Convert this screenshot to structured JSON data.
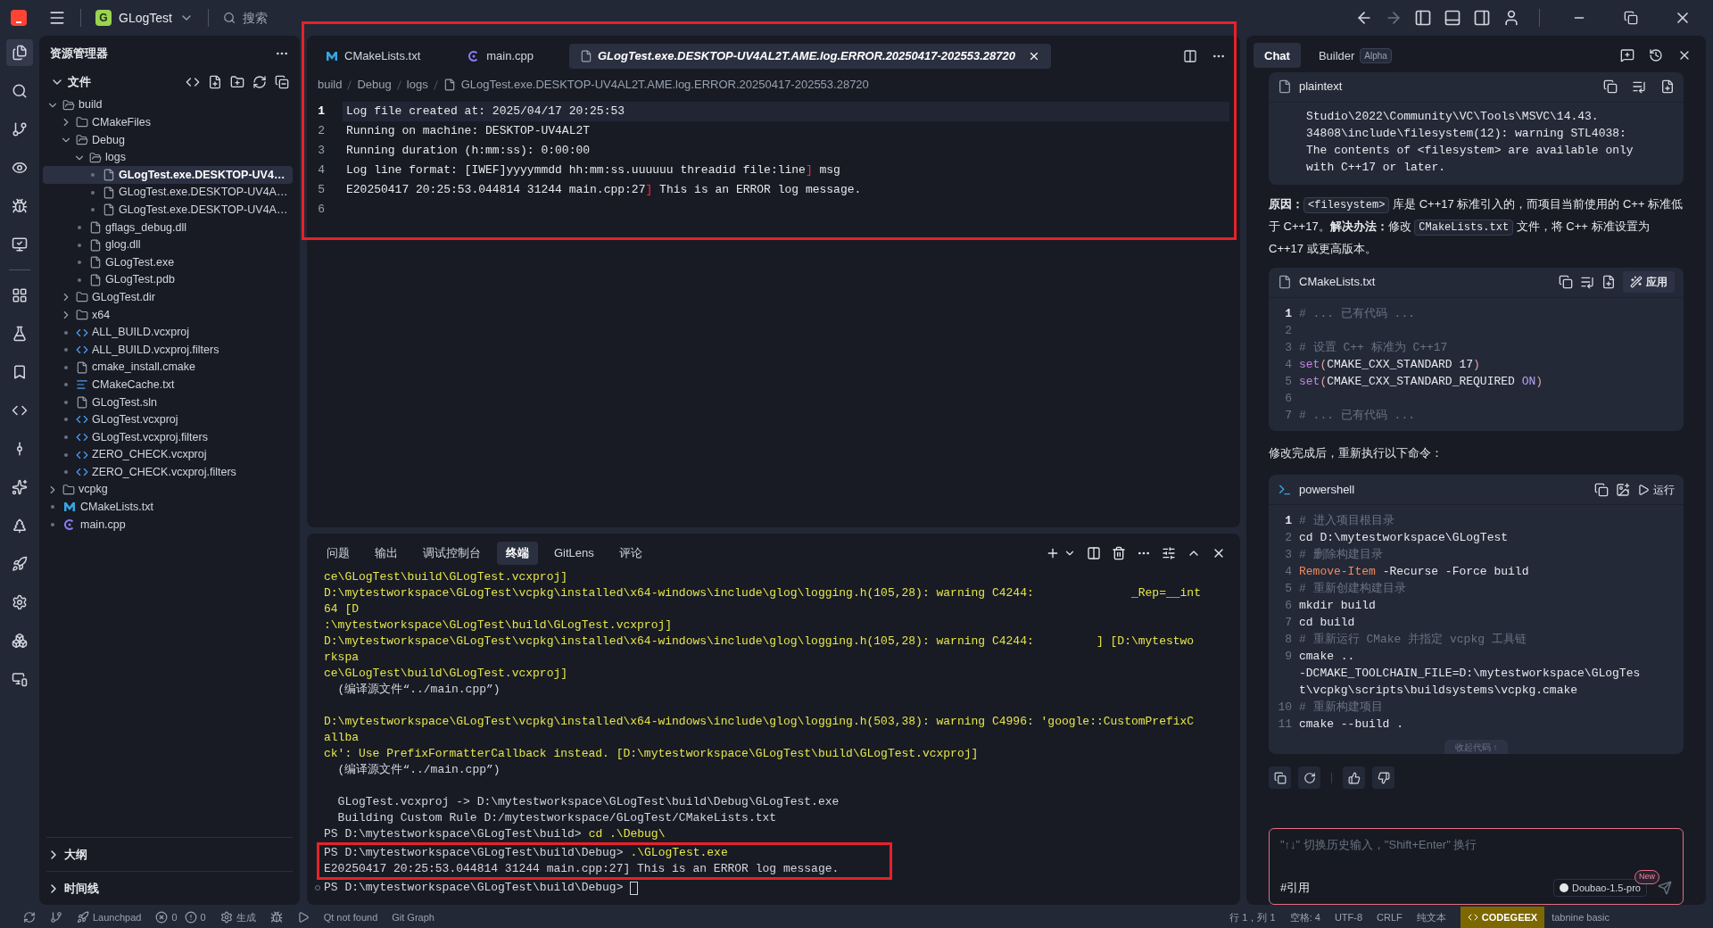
{
  "title_bar": {
    "project_badge": "G",
    "project": "GLogTest",
    "search": {
      "placeholder": "搜索"
    }
  },
  "explorer": {
    "title": "资源管理器",
    "section": "文件",
    "tree": [
      {
        "name": "build",
        "kind": "folder",
        "expanded": true,
        "selected": false,
        "children": [
          {
            "name": "CMakeFiles",
            "kind": "folder",
            "expanded": false,
            "selected": false
          },
          {
            "name": "Debug",
            "kind": "folder",
            "expanded": true,
            "selected": false,
            "children": [
              {
                "name": "logs",
                "kind": "folder",
                "expanded": true,
                "selected": false,
                "children": [
                  {
                    "name": "GLogTest.exe.DESKTOP-UV4…",
                    "kind": "file",
                    "selected": true
                  },
                  {
                    "name": "GLogTest.exe.DESKTOP-UV4A…",
                    "kind": "file",
                    "selected": false
                  },
                  {
                    "name": "GLogTest.exe.DESKTOP-UV4A…",
                    "kind": "file",
                    "selected": false
                  }
                ]
              },
              {
                "name": "gflags_debug.dll",
                "kind": "file",
                "selected": false
              },
              {
                "name": "glog.dll",
                "kind": "file",
                "selected": false
              },
              {
                "name": "GLogTest.exe",
                "kind": "file",
                "selected": false
              },
              {
                "name": "GLogTest.pdb",
                "kind": "file",
                "selected": false
              }
            ]
          },
          {
            "name": "GLogTest.dir",
            "kind": "folder",
            "expanded": false,
            "selected": false
          },
          {
            "name": "x64",
            "kind": "folder",
            "expanded": false,
            "selected": false
          },
          {
            "name": "ALL_BUILD.vcxproj",
            "kind": "code",
            "selected": false
          },
          {
            "name": "ALL_BUILD.vcxproj.filters",
            "kind": "code",
            "selected": false
          },
          {
            "name": "cmake_install.cmake",
            "kind": "file",
            "selected": false
          },
          {
            "name": "CMakeCache.txt",
            "kind": "list",
            "selected": false
          },
          {
            "name": "GLogTest.sln",
            "kind": "file",
            "selected": false
          },
          {
            "name": "GLogTest.vcxproj",
            "kind": "code",
            "selected": false
          },
          {
            "name": "GLogTest.vcxproj.filters",
            "kind": "code",
            "selected": false
          },
          {
            "name": "ZERO_CHECK.vcxproj",
            "kind": "code",
            "selected": false
          },
          {
            "name": "ZERO_CHECK.vcxproj.filters",
            "kind": "code",
            "selected": false
          }
        ]
      },
      {
        "name": "vcpkg",
        "kind": "folder",
        "expanded": false,
        "selected": false
      },
      {
        "name": "CMakeLists.txt",
        "kind": "cmake",
        "selected": false
      },
      {
        "name": "main.cpp",
        "kind": "cpp",
        "selected": false
      }
    ],
    "bottom_sections": [
      {
        "label": "大纲",
        "expanded": false
      },
      {
        "label": "时间线",
        "expanded": false
      }
    ]
  },
  "editor": {
    "tabs": [
      {
        "label": "CMakeLists.txt",
        "kind": "cmake",
        "selected": false
      },
      {
        "label": "main.cpp",
        "kind": "cpp",
        "selected": false
      },
      {
        "label": "GLogTest.exe.DESKTOP-UV4AL2T.AME.log.ERROR.20250417-202553.28720",
        "kind": "file",
        "selected": true
      }
    ],
    "breadcrumb": [
      "build",
      "Debug",
      "logs",
      "GLogTest.exe.DESKTOP-UV4AL2T.AME.log.ERROR.20250417-202553.28720"
    ],
    "lines": [
      {
        "number": "1",
        "selected": true,
        "segments": [
          {
            "kind": "text",
            "text": "Log file created at: 2025/04/17 20:25:53"
          }
        ]
      },
      {
        "number": "2",
        "selected": false,
        "segments": [
          {
            "kind": "text",
            "text": "Running on machine: DESKTOP-UV4AL2T"
          }
        ]
      },
      {
        "number": "3",
        "selected": false,
        "segments": [
          {
            "kind": "text",
            "text": "Running duration (h:mm:ss): 0:00:00"
          }
        ]
      },
      {
        "number": "4",
        "selected": false,
        "segments": [
          {
            "kind": "text",
            "text": "Log line format: [IWEF]yyyymmdd hh:mm:ss.uuuuuu threadid file:line"
          },
          {
            "kind": "bracket",
            "text": "]"
          },
          {
            "kind": "text",
            "text": " msg"
          }
        ]
      },
      {
        "number": "5",
        "selected": false,
        "segments": [
          {
            "kind": "text",
            "text": "E20250417 20:25:53.044814 31244 main.cpp:27"
          },
          {
            "kind": "bracket",
            "text": "]"
          },
          {
            "kind": "text",
            "text": " This is an ERROR log message."
          }
        ]
      },
      {
        "number": "6",
        "selected": false
      }
    ]
  },
  "panel": {
    "tabs": [
      {
        "label": "问题",
        "selected": false
      },
      {
        "label": "输出",
        "selected": false
      },
      {
        "label": "调试控制台",
        "selected": false
      },
      {
        "label": "终端",
        "selected": true
      },
      {
        "label": "GitLens",
        "selected": false
      },
      {
        "label": "评论",
        "selected": false
      }
    ],
    "terminal_lines": [
      {
        "kind": "warning",
        "text": "ce\\GLogTest\\build\\GLogTest.vcxproj]"
      },
      {
        "kind": "warning",
        "text": "D:\\mytestworkspace\\GLogTest\\vcpkg\\installed\\x64-windows\\include\\glog\\logging.h(105,28): warning C4244:              _Rep=__int"
      },
      {
        "kind": "warning",
        "text": "64 [D"
      },
      {
        "kind": "warning",
        "text": ":\\mytestworkspace\\GLogTest\\build\\GLogTest.vcxproj]"
      },
      {
        "kind": "warning",
        "text": "D:\\mytestworkspace\\GLogTest\\vcpkg\\installed\\x64-windows\\include\\glog\\logging.h(105,28): warning C4244:         ] [D:\\mytestwo"
      },
      {
        "kind": "warning",
        "text": "rkspa"
      },
      {
        "kind": "warning",
        "text": "ce\\GLogTest\\build\\GLogTest.vcxproj]"
      },
      {
        "kind": "normal",
        "text": "  (编译源文件“../main.cpp”)"
      },
      {
        "kind": "blank"
      },
      {
        "kind": "warning",
        "text": "D:\\mytestworkspace\\GLogTest\\vcpkg\\installed\\x64-windows\\include\\glog\\logging.h(503,38): warning C4996: 'google::CustomPrefixC"
      },
      {
        "kind": "warning",
        "text": "allba"
      },
      {
        "kind": "warning",
        "text": "ck': Use PrefixFormatterCallback instead. [D:\\mytestworkspace\\GLogTest\\build\\GLogTest.vcxproj]"
      },
      {
        "kind": "normal",
        "text": "  (编译源文件“../main.cpp”)"
      },
      {
        "kind": "blank"
      },
      {
        "kind": "normal",
        "text": "  GLogTest.vcxproj -> D:\\mytestworkspace\\GLogTest\\build\\Debug\\GLogTest.exe"
      },
      {
        "kind": "normal",
        "text": "  Building Custom Rule D:/mytestworkspace/GLogTest/CMakeLists.txt"
      },
      {
        "kind": "prompt",
        "prompt": "PS D:\\mytestworkspace\\GLogTest\\build>",
        "command": "cd .\\Debug\\"
      }
    ],
    "highlighted_lines": [
      {
        "kind": "prompt",
        "prompt": "PS D:\\mytestworkspace\\GLogTest\\build\\Debug>",
        "command": ".\\GLogTest.exe"
      },
      {
        "kind": "normal",
        "text": "E20250417 20:25:53.044814 31244 main.cpp:27] This is an ERROR log message."
      }
    ],
    "active_prompt": "PS D:\\mytestworkspace\\GLogTest\\build\\Debug>"
  },
  "chat": {
    "tabs": [
      {
        "label": "Chat",
        "selected": true
      },
      {
        "label": "Builder",
        "badge": "Alpha",
        "selected": false
      }
    ],
    "plaintext_block": {
      "language": "plaintext",
      "lines": [
        "Studio\\2022\\Community\\VC\\Tools\\MSVC\\14.43.",
        "34808\\include\\filesystem(12): warning STL4038:",
        "The contents of <filesystem> are available only",
        "with C++17 or later."
      ]
    },
    "explanation": [
      {
        "kind": "bold",
        "text": "原因："
      },
      {
        "kind": "code",
        "text": "<filesystem>"
      },
      {
        "kind": "text",
        "text": " 库是 C++17 标准引入的，而项目当前使用的 C++ 标准低于 C++17。"
      },
      {
        "kind": "bold",
        "text": "解决办法："
      },
      {
        "kind": "text",
        "text": "修改 "
      },
      {
        "kind": "code",
        "text": "CMakeLists.txt"
      },
      {
        "kind": "text",
        "text": " 文件，将 C++ 标准设置为 C++17 或更高版本。"
      }
    ],
    "cmake_block": {
      "language": "CMakeLists.txt",
      "apply": "应用",
      "lines": [
        {
          "number": "1",
          "segments": [
            {
              "kind": "comment",
              "text": "# ... 已有代码 ..."
            }
          ]
        },
        {
          "number": "2"
        },
        {
          "number": "3",
          "segments": [
            {
              "kind": "comment",
              "text": "# 设置 C++ 标准为 C++17"
            }
          ]
        },
        {
          "number": "4",
          "segments": [
            {
              "kind": "keyword",
              "text": "set"
            },
            {
              "kind": "paren",
              "text": "("
            },
            {
              "kind": "text",
              "text": "CMAKE_CXX_STANDARD 17"
            },
            {
              "kind": "paren",
              "text": ")"
            }
          ]
        },
        {
          "number": "5",
          "segments": [
            {
              "kind": "keyword",
              "text": "set"
            },
            {
              "kind": "paren",
              "text": "("
            },
            {
              "kind": "text",
              "text": "CMAKE_CXX_STANDARD_REQUIRED "
            },
            {
              "kind": "constant",
              "text": "ON"
            },
            {
              "kind": "paren",
              "text": ")"
            }
          ]
        },
        {
          "number": "6"
        },
        {
          "number": "7",
          "segments": [
            {
              "kind": "comment",
              "text": "# ... 已有代码 ..."
            }
          ]
        }
      ]
    },
    "after_text": "修改完成后，重新执行以下命令：",
    "shell_block": {
      "language": "powershell",
      "run": "运行",
      "collapse": "收起代码 ↑",
      "lines": [
        {
          "number": "1",
          "segments": [
            {
              "kind": "comment",
              "text": "# 进入项目根目录"
            }
          ]
        },
        {
          "number": "2",
          "segments": [
            {
              "kind": "text",
              "text": "cd D:\\mytestworkspace\\GLogTest"
            }
          ]
        },
        {
          "number": "3",
          "segments": [
            {
              "kind": "comment",
              "text": "# 删除构建目录"
            }
          ]
        },
        {
          "number": "4",
          "segments": [
            {
              "kind": "command",
              "text": "Remove-Item"
            },
            {
              "kind": "text",
              "text": " -Recurse -Force build"
            }
          ]
        },
        {
          "number": "5",
          "segments": [
            {
              "kind": "comment",
              "text": "# 重新创建构建目录"
            }
          ]
        },
        {
          "number": "6",
          "segments": [
            {
              "kind": "text",
              "text": "mkdir build"
            }
          ]
        },
        {
          "number": "7",
          "segments": [
            {
              "kind": "text",
              "text": "cd build"
            }
          ]
        },
        {
          "number": "8",
          "segments": [
            {
              "kind": "comment",
              "text": "# 重新运行 CMake 并指定 vcpkg 工具链"
            }
          ]
        },
        {
          "number": "9",
          "segments": [
            {
              "kind": "text",
              "text": "cmake .."
            }
          ],
          "wrapped": [
            "-DCMAKE_TOOLCHAIN_FILE=D:\\mytestworkspace\\GLogTes",
            "t\\vcpkg\\scripts\\buildsystems\\vcpkg.cmake"
          ]
        },
        {
          "number": "10",
          "segments": [
            {
              "kind": "comment",
              "text": "# 重新构建项目"
            }
          ]
        },
        {
          "number": "11",
          "segments": [
            {
              "kind": "text",
              "text": "cmake --build ."
            }
          ]
        }
      ]
    },
    "input": {
      "placeholder": "\"↑↓\" 切换历史输入，\"Shift+Enter\" 换行",
      "reference": "#引用",
      "model": "Doubao-1.5-pro",
      "model_badge": "New"
    }
  },
  "status_bar": {
    "launchpad": "Launchpad",
    "errors": "0",
    "warnings": "0",
    "build": "生成",
    "qt": "Qt not found",
    "git_graph": "Git Graph",
    "position": "行 1，列 1",
    "spaces": "空格: 4",
    "encoding": "UTF-8",
    "eol": "CRLF",
    "language": "纯文本",
    "codegeex": "CODEGEEX",
    "tabnine": "tabnine basic"
  }
}
